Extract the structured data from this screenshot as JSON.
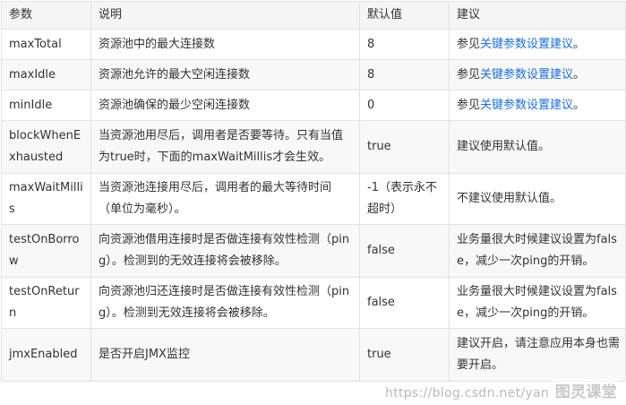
{
  "table": {
    "headers": [
      "参数",
      "说明",
      "默认值",
      "建议"
    ],
    "rows": [
      {
        "param": "maxTotal",
        "desc": "资源池中的最大连接数",
        "default": "8",
        "advice": {
          "prefix": "参见",
          "link": "关键参数设置建议",
          "suffix": "。"
        }
      },
      {
        "param": "maxIdle",
        "desc": "资源池允许的最大空闲连接数",
        "default": "8",
        "advice": {
          "prefix": "参见",
          "link": "关键参数设置建议",
          "suffix": "。"
        }
      },
      {
        "param": "minIdle",
        "desc": "资源池确保的最少空闲连接数",
        "default": "0",
        "advice": {
          "prefix": "参见",
          "link": "关键参数设置建议",
          "suffix": "。"
        }
      },
      {
        "param": "blockWhenExhausted",
        "desc": "当资源池用尽后，调用者是否要等待。只有当值为true时，下面的maxWaitMillis才会生效。",
        "default": "true",
        "advice": {
          "prefix": "建议使用默认值。",
          "link": "",
          "suffix": ""
        }
      },
      {
        "param": "maxWaitMillis",
        "desc": "当资源池连接用尽后，调用者的最大等待时间（单位为毫秒）。",
        "default": "-1（表示永不超时）",
        "advice": {
          "prefix": "不建议使用默认值。",
          "link": "",
          "suffix": ""
        }
      },
      {
        "param": "testOnBorrow",
        "desc": "向资源池借用连接时是否做连接有效性检测（ping）。检测到的无效连接将会被移除。",
        "default": "false",
        "advice": {
          "prefix": "业务量很大时候建议设置为false，减少一次ping的开销。",
          "link": "",
          "suffix": ""
        }
      },
      {
        "param": "testOnReturn",
        "desc": "向资源池归还连接时是否做连接有效性检测（ping）。检测到无效连接将会被移除。",
        "default": "false",
        "advice": {
          "prefix": "业务量很大时候建议设置为false，减少一次ping的开销。",
          "link": "",
          "suffix": ""
        }
      },
      {
        "param": "jmxEnabled",
        "desc": "是否开启JMX监控",
        "default": "true",
        "advice": {
          "prefix": "建议开启，请注意应用本身也需要开启。",
          "link": "",
          "suffix": ""
        }
      }
    ]
  },
  "watermark": {
    "text": "https://blog.csdn.net/yan",
    "logo": "图灵课堂"
  }
}
